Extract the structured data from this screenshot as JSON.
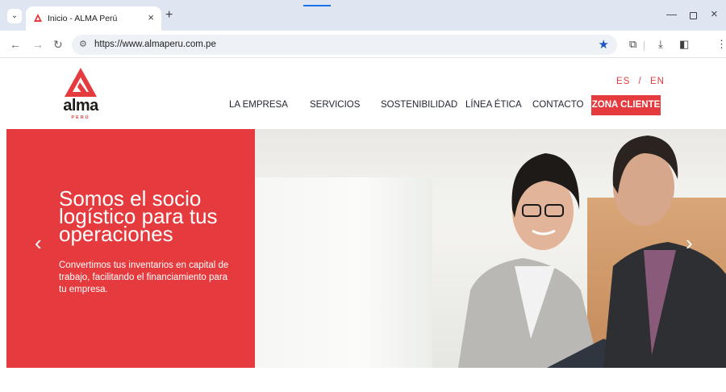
{
  "browser": {
    "tab_title": "Inicio - ALMA Perú",
    "url": "https://www.almaperu.com.pe"
  },
  "icons": {
    "tab_list": "chevron-down-icon",
    "favicon": "alma-favicon-icon",
    "close_tab": "close-icon",
    "new_tab": "plus-icon",
    "back": "arrow-left-icon",
    "forward": "arrow-right-icon",
    "reload": "reload-icon",
    "site_info": "tune-icon",
    "bookmark": "star-icon",
    "extensions": "puzzle-icon",
    "downloads": "download-icon",
    "sidebar": "sidebar-icon",
    "menu": "kebab-menu-icon",
    "prev_slide": "chevron-left-icon",
    "next_slide": "chevron-right-icon"
  },
  "site": {
    "logo_word": "alma",
    "logo_sub": "PERÚ",
    "lang_es": "ES",
    "lang_sep": "/",
    "lang_en": "EN",
    "nav": [
      "LA EMPRESA",
      "SERVICIOS",
      "SOSTENIBILIDAD",
      "LÍNEA ÉTICA",
      "CONTACTO"
    ],
    "cta": "ZONA CLIENTE"
  },
  "hero": {
    "title": "Somos el socio logístico para tus operaciones",
    "subtitle": "Convertimos tus inventarios en capital de trabajo, facilitando el financiamiento para tu empresa."
  },
  "colors": {
    "brand_red": "#e63b3e",
    "chrome_bg": "#dfe6f1",
    "nav_text": "#1f2430"
  }
}
